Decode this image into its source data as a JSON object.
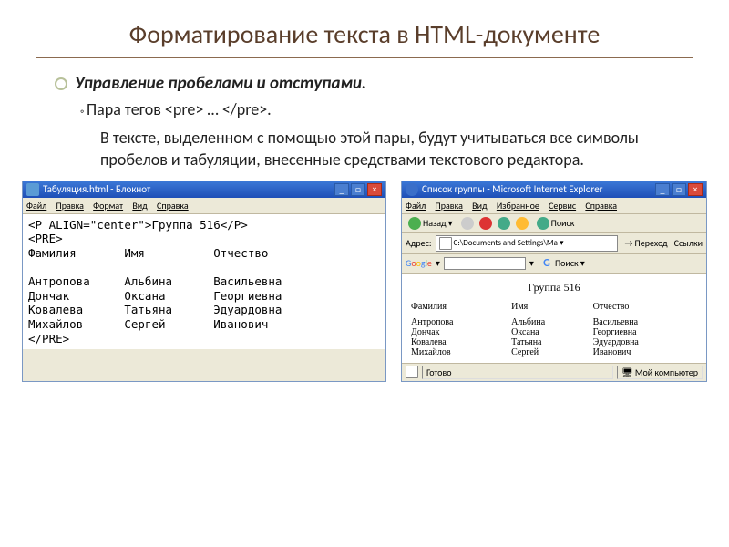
{
  "slide": {
    "title": "Форматирование текста в HTML-документе",
    "bullet1": "Управление пробелами и отступами.",
    "sub1": "Пара тегов <pre> … </pre>.",
    "para1": "В тексте, выделенном с помощью этой пары, будут учитываться все символы пробелов и табуляции, внесенные средствами текстового редактора."
  },
  "notepad": {
    "title": "Табуляция.html - Блокнот",
    "menus": {
      "file": "Файл",
      "edit": "Правка",
      "format": "Формат",
      "view": "Вид",
      "help": "Справка"
    },
    "code": "<P ALIGN=\"center\">Группа 516</P>\n<PRE>\nФамилия       Имя          Отчество\n\nАнтропова     Альбина      Васильевна\nДончак        Оксана       Георгиевна\nКовалева      Татьяна      Эдуардовна\nМихайлов      Сергей       Иванович\n</PRE>"
  },
  "ie": {
    "title": "Список группы - Microsoft Internet Explorer",
    "menus": {
      "file": "Файл",
      "edit": "Правка",
      "view": "Вид",
      "fav": "Избранное",
      "svc": "Сервис",
      "help": "Справка"
    },
    "back": "Назад",
    "search": "Поиск",
    "addr_label": "Адрес:",
    "addr_value": "C:\\Documents and Settings\\Ма",
    "go": "Переход",
    "links": "Ссылки",
    "goog_label": "Google",
    "goog_search": "Поиск",
    "group_title": "Группа 516",
    "headers": {
      "fam": "Фамилия",
      "name": "Имя",
      "patr": "Отчество"
    },
    "rows": [
      {
        "fam": "Антропова",
        "name": "Альбина",
        "patr": "Васильевна"
      },
      {
        "fam": "Дончак",
        "name": "Оксана",
        "patr": "Георгиевна"
      },
      {
        "fam": "Ковалева",
        "name": "Татьяна",
        "patr": "Эдуардовна"
      },
      {
        "fam": "Михайлов",
        "name": "Сергей",
        "patr": "Иванович"
      }
    ],
    "status_done": "Готово",
    "status_zone": "Мой компьютер"
  }
}
